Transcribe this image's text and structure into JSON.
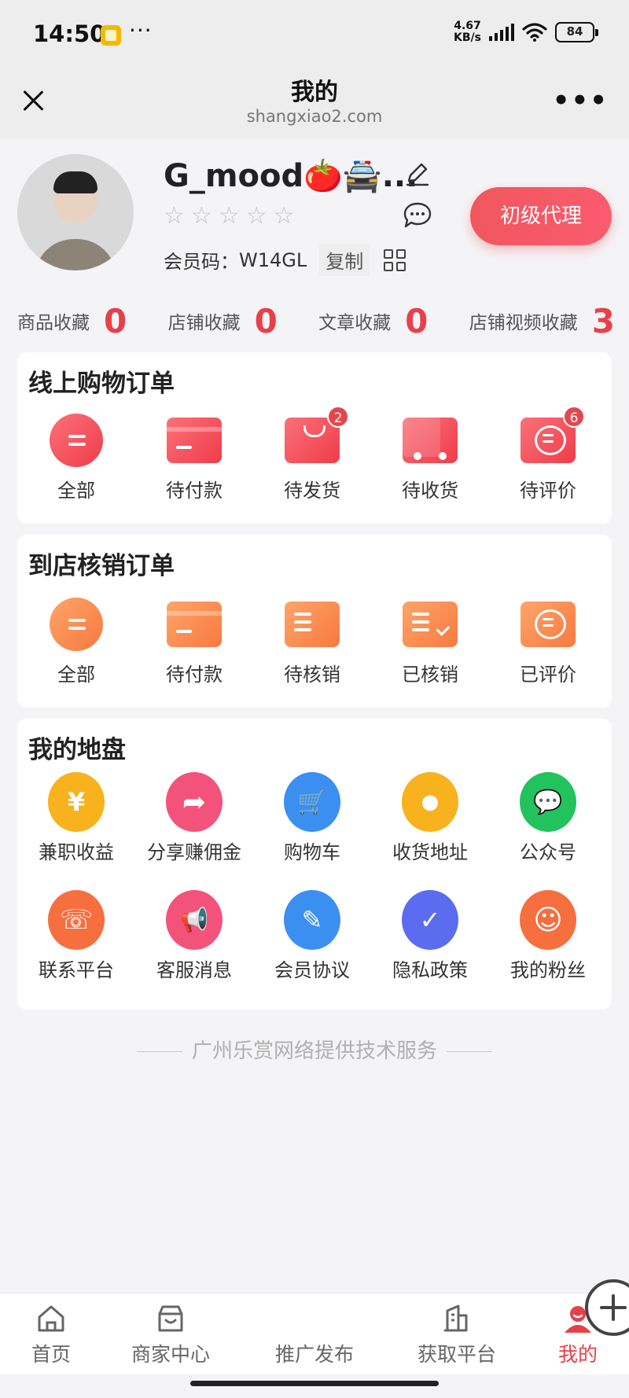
{
  "status_bar": {
    "time": "14:50",
    "dots": "···",
    "net_speed_value": "4.67",
    "net_speed_unit": "KB/s",
    "battery": "84"
  },
  "header": {
    "title": "我的",
    "url": "shangxiao2.com",
    "more": "•••"
  },
  "profile": {
    "username": "G_mood🍅🚔...",
    "stars_total": 5,
    "stars_filled": 0,
    "member_code_label": "会员码：",
    "member_code": "W14GL",
    "copy_label": "复制",
    "agent_button": "初级代理"
  },
  "favorites": [
    {
      "label": "商品收藏",
      "count": "0"
    },
    {
      "label": "店铺收藏",
      "count": "0"
    },
    {
      "label": "文章收藏",
      "count": "0"
    },
    {
      "label": "店铺视频收藏",
      "count": "3"
    }
  ],
  "online_orders": {
    "title": "线上购物订单",
    "items": [
      {
        "label": "全部",
        "icon": "all-orders-icon",
        "badge": ""
      },
      {
        "label": "待付款",
        "icon": "pending-payment-icon",
        "badge": ""
      },
      {
        "label": "待发货",
        "icon": "pending-shipment-icon",
        "badge": "2"
      },
      {
        "label": "待收货",
        "icon": "truck-icon",
        "badge": ""
      },
      {
        "label": "待评价",
        "icon": "review-icon",
        "badge": "6"
      }
    ]
  },
  "store_orders": {
    "title": "到店核销订单",
    "items": [
      {
        "label": "全部",
        "icon": "all-orders-icon"
      },
      {
        "label": "待付款",
        "icon": "pending-payment-icon"
      },
      {
        "label": "待核销",
        "icon": "pending-verify-icon"
      },
      {
        "label": "已核销",
        "icon": "verified-icon"
      },
      {
        "label": "已评价",
        "icon": "reviewed-icon"
      }
    ]
  },
  "territory": {
    "title": "我的地盘",
    "items": [
      {
        "label": "兼职收益",
        "icon": "money-bag-icon",
        "glyph": "¥",
        "color": "#f7b21e"
      },
      {
        "label": "分享赚佣金",
        "icon": "share-icon",
        "glyph": "➦",
        "color": "#f3537a"
      },
      {
        "label": "购物车",
        "icon": "cart-icon",
        "glyph": "🛒",
        "color": "#3b8ff0"
      },
      {
        "label": "收货地址",
        "icon": "location-pin-icon",
        "glyph": "●",
        "color": "#f7b21e"
      },
      {
        "label": "公众号",
        "icon": "wechat-icon",
        "glyph": "💬",
        "color": "#22c35d"
      },
      {
        "label": "联系平台",
        "icon": "headset-icon",
        "glyph": "☏",
        "color": "#f76e3f"
      },
      {
        "label": "客服消息",
        "icon": "megaphone-icon",
        "glyph": "📢",
        "color": "#f3537a"
      },
      {
        "label": "会员协议",
        "icon": "document-icon",
        "glyph": "✎",
        "color": "#3b8ff0"
      },
      {
        "label": "隐私政策",
        "icon": "shield-icon",
        "glyph": "✓",
        "color": "#5b6cf0"
      },
      {
        "label": "我的粉丝",
        "icon": "fans-icon",
        "glyph": "☺",
        "color": "#f76e3f"
      }
    ]
  },
  "footer": "广州乐赏网络提供技术服务",
  "bottom_nav": [
    {
      "label": "首页",
      "icon": "home-icon"
    },
    {
      "label": "商家中心",
      "icon": "store-icon"
    },
    {
      "label": "推广发布",
      "icon": "plus-icon"
    },
    {
      "label": "获取平台",
      "icon": "building-icon"
    },
    {
      "label": "我的",
      "icon": "profile-icon",
      "active": true
    }
  ],
  "colors": {
    "accent": "#e8404a",
    "orange": "#f77a3f",
    "background": "#f4f4f6"
  }
}
